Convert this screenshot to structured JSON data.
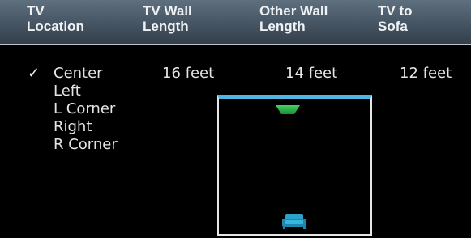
{
  "headers": {
    "location": [
      "TV",
      "Location"
    ],
    "tv_wall": [
      "TV Wall",
      "Length"
    ],
    "other_wall": [
      "Other Wall",
      "Length"
    ],
    "tv_to_sofa": [
      "TV to",
      "Sofa"
    ]
  },
  "values": {
    "tv_wall_length": "16 feet",
    "other_wall_length": "14 feet",
    "tv_to_sofa": "12 feet"
  },
  "location_options": [
    {
      "label": "Center",
      "selected": true
    },
    {
      "label": "Left",
      "selected": false
    },
    {
      "label": "L Corner",
      "selected": false
    },
    {
      "label": "Right",
      "selected": false
    },
    {
      "label": "R Corner",
      "selected": false
    }
  ],
  "check_glyph": "✓",
  "colors": {
    "header": "#4a5968",
    "room_wall": "#4fb6e3",
    "tv": "#2fb84a",
    "sofa": "#2aa3c9"
  },
  "icons": {
    "tv": "tv-icon",
    "sofa": "sofa-icon"
  }
}
